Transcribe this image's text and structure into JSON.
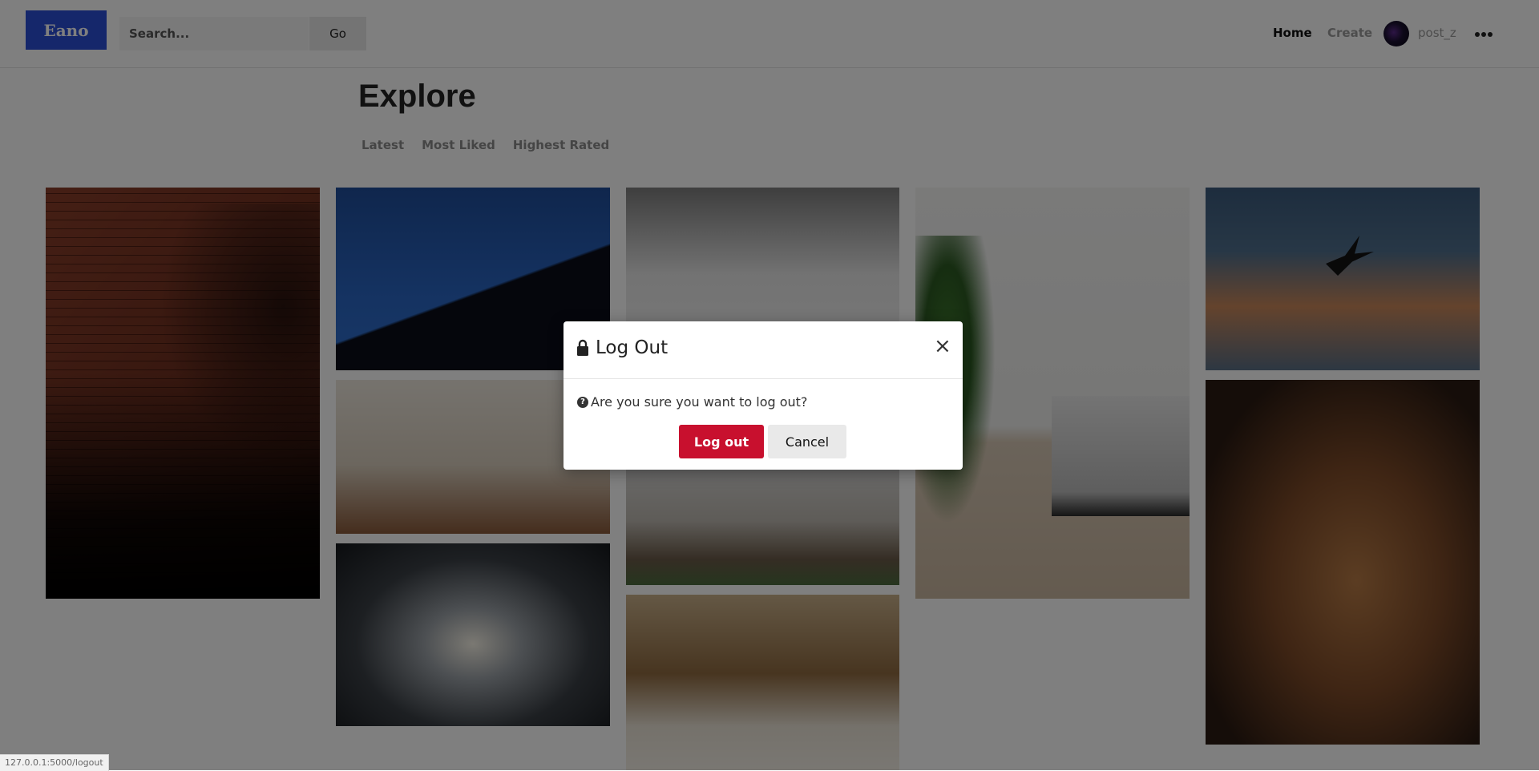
{
  "navbar": {
    "logo_text": "Eano",
    "search_placeholder": "Search...",
    "go_label": "Go",
    "home_label": "Home",
    "create_label": "Create",
    "username": "post_z"
  },
  "explore": {
    "title": "Explore",
    "tabs": [
      "Latest",
      "Most Liked",
      "Highest Rated"
    ]
  },
  "modal": {
    "title": "Log Out",
    "close_symbol": "×",
    "question_symbol": "?",
    "message": "Are you sure you want to log out?",
    "logout_label": "Log out",
    "cancel_label": "Cancel"
  },
  "status_url": "127.0.0.1:5000/logout",
  "colors": {
    "logo_bg": "#2b4fd6",
    "danger": "#c8102e",
    "overlay": "rgba(0,0,0,0.5)"
  },
  "icons": [
    "lock-icon",
    "close-icon",
    "question-circle-icon",
    "more-horizontal-icon",
    "avatar"
  ]
}
